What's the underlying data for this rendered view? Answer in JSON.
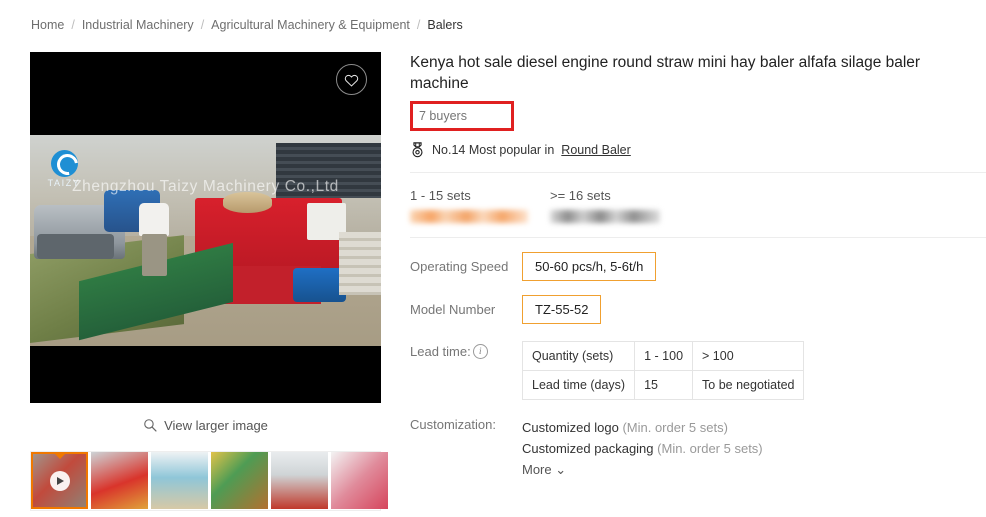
{
  "breadcrumb": {
    "items": [
      {
        "label": "Home"
      },
      {
        "label": "Industrial Machinery"
      },
      {
        "label": "Agricultural Machinery & Equipment"
      },
      {
        "label": "Balers"
      }
    ],
    "separator": "/"
  },
  "gallery": {
    "watermark": "Zhengzhou Taizy Machinery Co.,Ltd",
    "brand_logo_text": "TAIZY",
    "wishlist_icon": "heart-icon",
    "view_larger_label": "View larger image",
    "view_larger_icon": "search-icon",
    "play_icon": "play-icon",
    "thumbnails": [
      {
        "name": "thumbnail-1-video",
        "active": true
      },
      {
        "name": "thumbnail-2",
        "active": false
      },
      {
        "name": "thumbnail-3",
        "active": false
      },
      {
        "name": "thumbnail-4",
        "active": false
      },
      {
        "name": "thumbnail-5",
        "active": false
      },
      {
        "name": "thumbnail-6",
        "active": false
      }
    ]
  },
  "product": {
    "title": "Kenya hot sale diesel engine round straw mini hay baler alfafa silage baler machine",
    "buyers": "7 buyers",
    "buyers_highlight_color": "#e02020",
    "rank_icon": "medal-icon",
    "rank_text": "No.14 Most popular in",
    "rank_category": "Round Baler"
  },
  "pricing": {
    "tiers": [
      {
        "quantity": "1 - 15 sets",
        "price_hidden": true,
        "price_style": "orange"
      },
      {
        "quantity": ">= 16 sets",
        "price_hidden": true,
        "price_style": "gray"
      }
    ]
  },
  "specs": [
    {
      "label": "Operating Speed",
      "value": "50-60 pcs/h, 5-6t/h",
      "highlight_color": "#f0a030"
    },
    {
      "label": "Model Number",
      "value": "TZ-55-52",
      "highlight_color": "#f0a030"
    }
  ],
  "lead_time": {
    "label": "Lead time:",
    "info_icon": "info-icon",
    "rows": [
      {
        "header": "Quantity (sets)",
        "cells": [
          "1 - 100",
          "> 100"
        ]
      },
      {
        "header": "Lead time (days)",
        "cells": [
          "15",
          "To be negotiated"
        ]
      }
    ]
  },
  "customization": {
    "label": "Customization:",
    "options": [
      {
        "name": "Customized logo",
        "min_order": "(Min. order 5 sets)"
      },
      {
        "name": "Customized packaging",
        "min_order": "(Min. order 5 sets)"
      }
    ],
    "more_label": "More"
  }
}
